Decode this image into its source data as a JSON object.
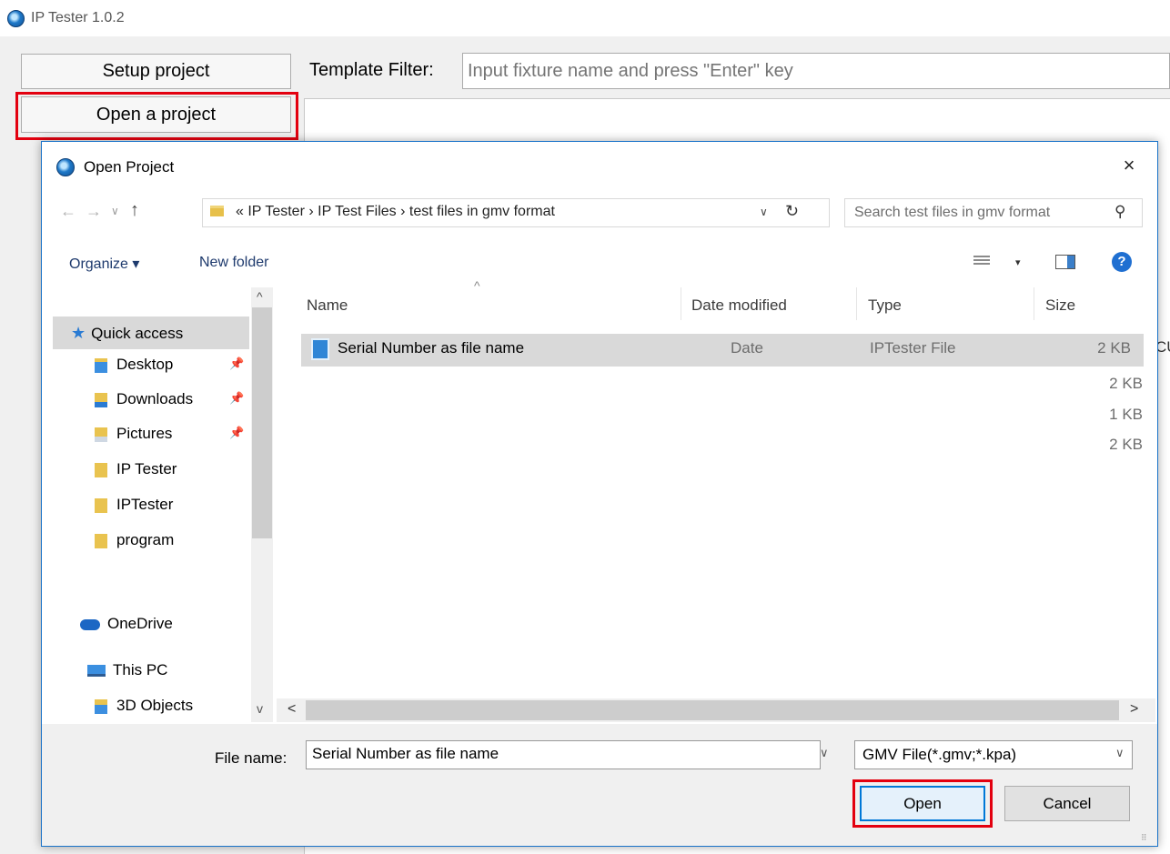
{
  "app": {
    "title": "IP Tester 1.0.2",
    "setup_label": "Setup project",
    "open_label": "Open a project",
    "filter_label": "Template Filter:",
    "filter_placeholder": "Input fixture name and press \"Enter\" key"
  },
  "dialog": {
    "title": "Open Project",
    "close": "×",
    "nav_back": "←",
    "nav_forward": "→",
    "nav_recent": "∨",
    "nav_up": "↑",
    "address": "«  IP Tester  ›  IP Test Files  ›  test files in gmv format",
    "address_drop": "∨",
    "refresh": "↻",
    "search_placeholder": "Search test files in gmv format",
    "search_icon": "⚲",
    "organize": "Organize ▾",
    "new_folder": "New folder",
    "view_drop": "▾",
    "help": "?",
    "sidebar": {
      "scroll_up": "^",
      "scroll_down": "v",
      "items": [
        {
          "label": "Quick access"
        },
        {
          "label": "Desktop"
        },
        {
          "label": "Downloads"
        },
        {
          "label": "Pictures"
        },
        {
          "label": "IP Tester"
        },
        {
          "label": "IPTester"
        },
        {
          "label": "program"
        },
        {
          "label": "OneDrive"
        },
        {
          "label": "This PC"
        },
        {
          "label": "3D Objects"
        }
      ],
      "pin": "📌"
    },
    "columns": {
      "name": "Name",
      "date": "Date modified",
      "type": "Type",
      "size": "Size",
      "sort": "^"
    },
    "files": [
      {
        "name": "Serial Number as file name",
        "date": "Date",
        "type": "IPTester File",
        "size": "2 KB"
      }
    ],
    "ghost_sizes": [
      "2 KB",
      "1 KB",
      "2 KB"
    ],
    "hscroll_left": "<",
    "hscroll_right": ">",
    "file_name_label": "File name:",
    "file_name_value": "Serial Number as file name",
    "file_type": "GMV File(*.gmv;*.kpa)",
    "dropdown_arrow": "∨",
    "open_button": "Open",
    "cancel_button": "Cancel",
    "grip": "⠿"
  },
  "background": {
    "peek_text": "CU"
  },
  "colors": {
    "highlight_outline": "#e3000f",
    "accent": "#0078d7"
  }
}
